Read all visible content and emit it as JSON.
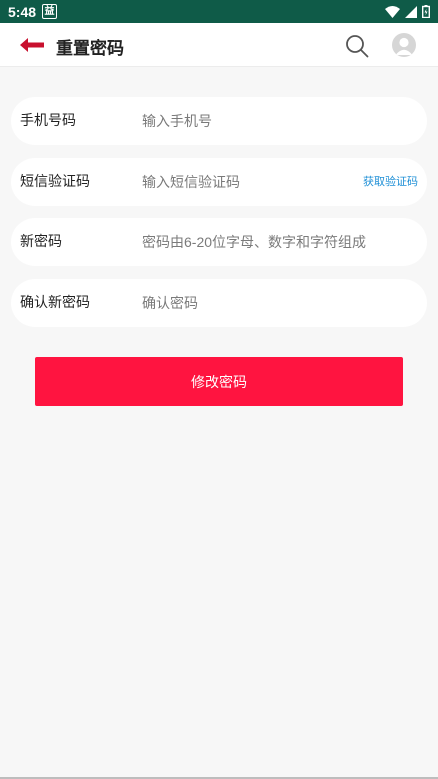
{
  "status_bar": {
    "time": "5:48",
    "app_icon_text": "益",
    "icons": [
      "wifi-icon",
      "signal-icon",
      "battery-icon"
    ]
  },
  "header": {
    "title": "重置密码",
    "back_icon": "back-arrow-icon",
    "search_icon": "search-icon",
    "avatar_icon": "avatar-icon"
  },
  "form": {
    "phone": {
      "label": "手机号码",
      "placeholder": "输入手机号",
      "value": ""
    },
    "sms": {
      "label": "短信验证码",
      "placeholder": "输入短信验证码",
      "value": "",
      "get_code": "获取验证码"
    },
    "new_password": {
      "label": "新密码",
      "placeholder": "密码由6-20位字母、数字和字符组成",
      "value": ""
    },
    "confirm_password": {
      "label": "确认新密码",
      "placeholder": "确认密码",
      "value": ""
    },
    "submit_label": "修改密码"
  },
  "colors": {
    "status_bar": "#0f5b48",
    "accent": "#ff1440",
    "back_arrow": "#c8102e",
    "link": "#1e8fd6",
    "background": "#f7f7f7"
  }
}
